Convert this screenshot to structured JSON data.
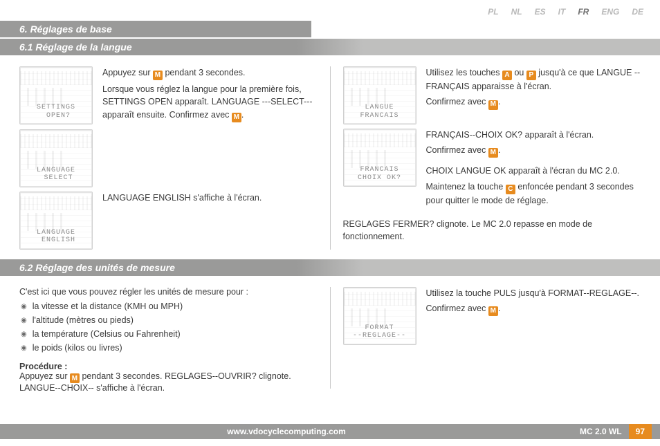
{
  "langs": [
    "PL",
    "NL",
    "ES",
    "IT",
    "FR",
    "ENG",
    "DE"
  ],
  "active_lang_index": 4,
  "section_title": "6.  Réglages de base",
  "sub61_title": "6.1  Réglage de la langue",
  "sub62_title": "6.2 Réglage des unités de mesure",
  "s61": {
    "left": {
      "thumb1": "SETTINGS\n OPEN?",
      "para1a": "Appuyez  sur ",
      "para1b": " pendant 3 secondes.",
      "para1c": "Lorsque vous réglez la langue pour la première fois, SETTINGS OPEN apparaît. LANGUAGE ---SELECT--- apparaît ensuite. Confirmez avec ",
      "thumb2": "LANGUAGE\n SELECT",
      "thumb3": "LANGUAGE\n ENGLISH",
      "para2": "LANGUAGE ENGLISH s'affiche à l'écran."
    },
    "right": {
      "thumb1": "LANGUE\nFRANCAIS",
      "para1a": "Utilisez les touches ",
      "para1b": " ou ",
      "para1c": " jusqu'à ce que LANGUE --FRANÇAIS apparaisse à l'écran.",
      "para1d": "Confirmez avec ",
      "thumb2": "FRANCAIS\nCHOIX OK?",
      "para2a": "FRANÇAIS--CHOIX OK? apparaît à l'écran.",
      "para2b": "Confirmez avec ",
      "para3a": "CHOIX LANGUE OK apparaît à l'écran du MC 2.0.",
      "para3b": "Maintenez la touche ",
      "para3c": " enfoncée pendant 3 secondes pour quitter le mode de réglage.",
      "closing": "REGLAGES FERMER? clignote. Le MC 2.0 repasse en mode de fonctionnement."
    }
  },
  "s62": {
    "intro": "C'est ici que vous pouvez régler les unités de mesure pour :",
    "bullets": [
      "la vitesse et la distance (KMH ou MPH)",
      "l'altitude (mètres ou pieds)",
      "la température (Celsius ou Fahrenheit)",
      "le poids (kilos ou livres)"
    ],
    "proc_hd": "Procédure :",
    "proc1a": "Appuyez  sur ",
    "proc1b": " pendant 3 secondes. REGLAGES--OUVRIR? clignote.",
    "proc2": "LANGUE--CHOIX-- s'affiche à l'écran.",
    "right": {
      "thumb1": "FORMAT\n--REGLAGE--",
      "para1a": "Utilisez la touche PULS jusqu'à FORMAT--REGLAGE--.",
      "para1b": "Confirmez avec "
    }
  },
  "footer": {
    "url": "www.vdocyclecomputing.com",
    "model": "MC 2.0 WL",
    "page": "97"
  }
}
